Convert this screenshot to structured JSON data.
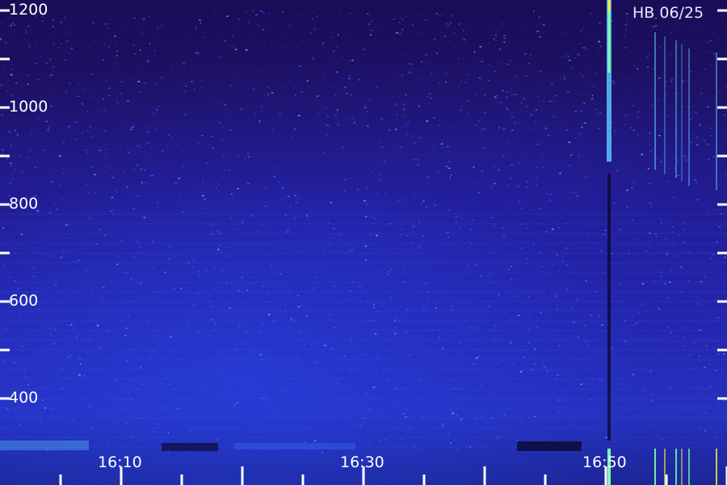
{
  "chart_data": {
    "type": "heatmap",
    "title": "",
    "xlabel": "",
    "ylabel": "",
    "ylim": [
      280,
      1200
    ],
    "y_ticks": [
      400,
      500,
      600,
      700,
      800,
      900,
      1000,
      1100,
      1200
    ],
    "y_tick_labels": [
      "1200",
      "1000",
      "800",
      "600",
      "400"
    ],
    "x_ticks": [
      "16:10",
      "16:30",
      "16:50"
    ],
    "stamp": "HB 06/25",
    "colormap": [
      "#1a0c56",
      "#2a22b8",
      "#3c63ff",
      "#5fd0ff",
      "#7dffb0",
      "#f8f040"
    ]
  }
}
